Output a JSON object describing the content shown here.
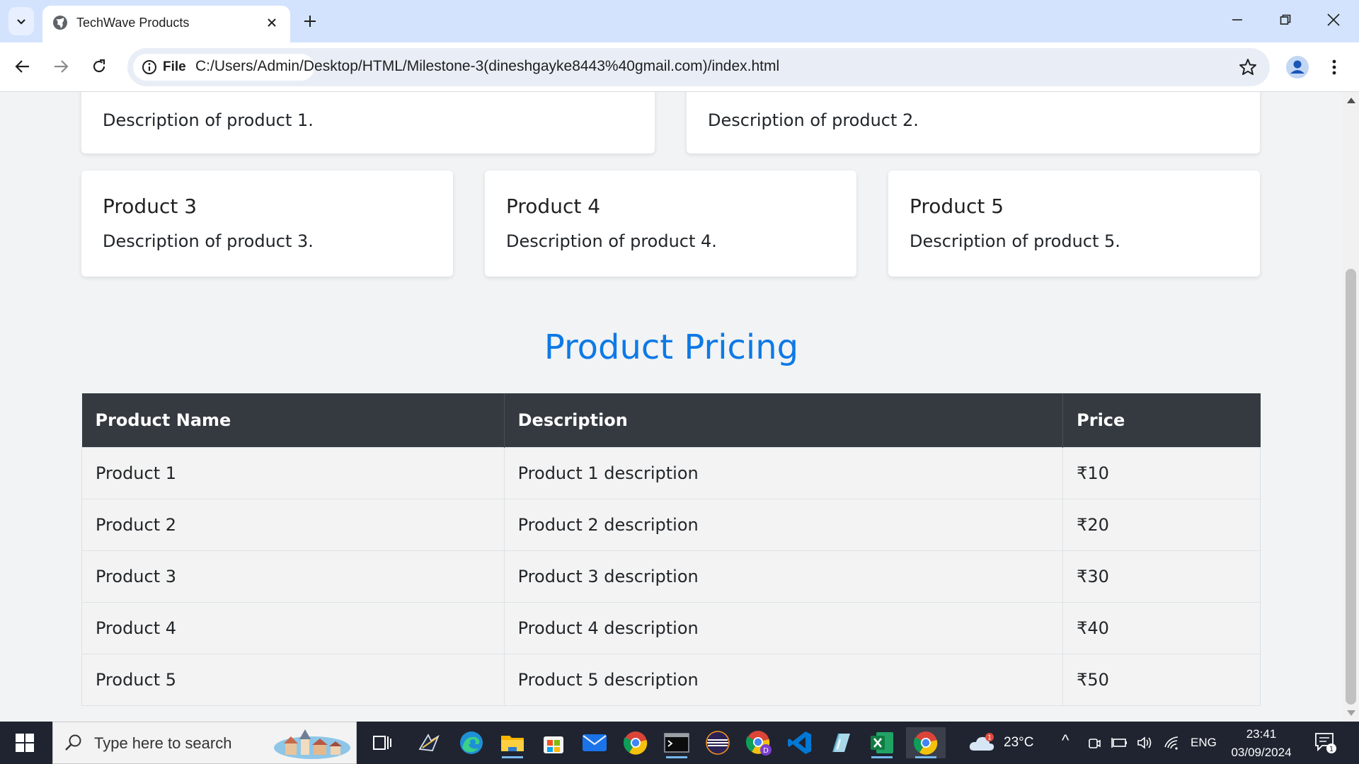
{
  "browser": {
    "tab_title": "TechWave Products",
    "site_chip": "File",
    "url": "C:/Users/Admin/Desktop/HTML/Milestone-3(dineshgayke8443%40gmail.com)/index.html"
  },
  "page": {
    "top_cards": [
      {
        "description": "Description of product 1."
      },
      {
        "description": "Description of product 2."
      }
    ],
    "cards": [
      {
        "title": "Product 3",
        "description": "Description of product 3."
      },
      {
        "title": "Product 4",
        "description": "Description of product 4."
      },
      {
        "title": "Product 5",
        "description": "Description of product 5."
      }
    ],
    "pricing_title": "Product Pricing",
    "table": {
      "headers": [
        "Product Name",
        "Description",
        "Price"
      ],
      "rows": [
        [
          "Product 1",
          "Product 1 description",
          "₹10"
        ],
        [
          "Product 2",
          "Product 2 description",
          "₹20"
        ],
        [
          "Product 3",
          "Product 3 description",
          "₹30"
        ],
        [
          "Product 4",
          "Product 4 description",
          "₹40"
        ],
        [
          "Product 5",
          "Product 5 description",
          "₹50"
        ]
      ]
    }
  },
  "taskbar": {
    "search_placeholder": "Type here to search",
    "weather": "23°C",
    "weather_badge": "1",
    "language": "ENG",
    "time": "23:41",
    "date": "03/09/2024",
    "notification_count": "1"
  },
  "colors": {
    "accent_title": "#0d79e6",
    "table_header": "#343a40"
  }
}
